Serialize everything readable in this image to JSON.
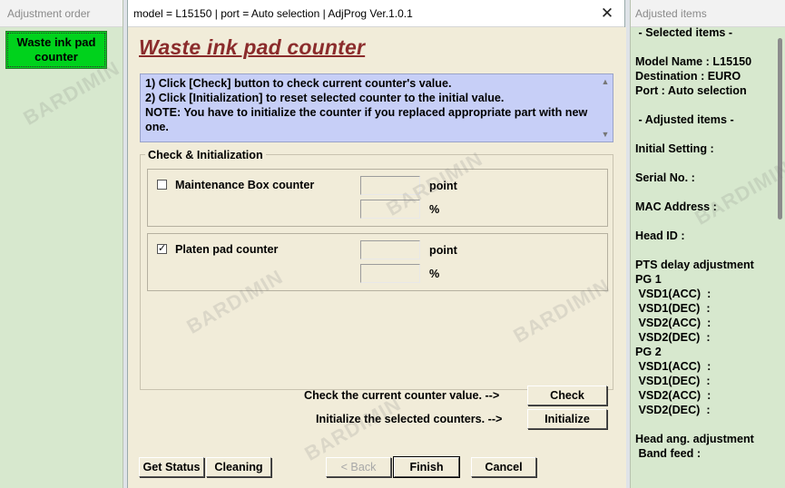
{
  "left_window": {
    "title": "Adjustment order",
    "items": [
      {
        "label": "Waste ink pad\ncounter",
        "selected": true
      }
    ]
  },
  "dialog": {
    "title": "model = L15150 | port = Auto selection | AdjProg Ver.1.0.1",
    "close_symbol": "✕",
    "heading": "Waste ink pad counter",
    "instructions": [
      "1) Click [Check] button to check current counter's value.",
      "2) Click [Initialization] to reset selected counter to the initial value.",
      "NOTE: You have to initialize the counter if you replaced appropriate part with new one."
    ],
    "group_title": "Check & Initialization",
    "counters": [
      {
        "label": "Maintenance Box counter",
        "checked": false,
        "point_value": "",
        "percent_value": "",
        "unit_point": "point",
        "unit_percent": "%"
      },
      {
        "label": "Platen pad counter",
        "checked": true,
        "point_value": "",
        "percent_value": "",
        "unit_point": "point",
        "unit_percent": "%"
      }
    ],
    "check_text": "Check the current counter value. -->",
    "check_button": "Check",
    "init_text": "Initialize the selected counters. -->",
    "init_button": "Initialize",
    "footer": {
      "get_status": "Get Status",
      "cleaning": "Cleaning",
      "back": "< Back",
      "finish": "Finish",
      "cancel": "Cancel"
    }
  },
  "right_window": {
    "title": "Adjusted items",
    "lines": [
      " - Selected items -",
      "",
      "Model Name : L15150",
      "Destination : EURO",
      "Port : Auto selection",
      "",
      " - Adjusted items -",
      "",
      "Initial Setting :",
      "",
      "Serial No. :",
      "",
      "MAC Address :",
      "",
      "Head ID :",
      "",
      "PTS delay adjustment",
      "PG 1",
      " VSD1(ACC)  :",
      " VSD1(DEC)  :",
      " VSD2(ACC)  :",
      " VSD2(DEC)  :",
      "PG 2",
      " VSD1(ACC)  :",
      " VSD1(DEC)  :",
      " VSD2(ACC)  :",
      " VSD2(DEC)  :",
      "",
      "Head ang. adjustment",
      " Band feed :"
    ]
  },
  "watermark": "BARDIMIN",
  "colors": {
    "selected_item_bg": "#00d21c",
    "heading": "#8b2c2c",
    "instructions_bg": "#c7cff7",
    "dialog_bg": "#f1ecd9",
    "side_bg": "#d7e8ce"
  }
}
